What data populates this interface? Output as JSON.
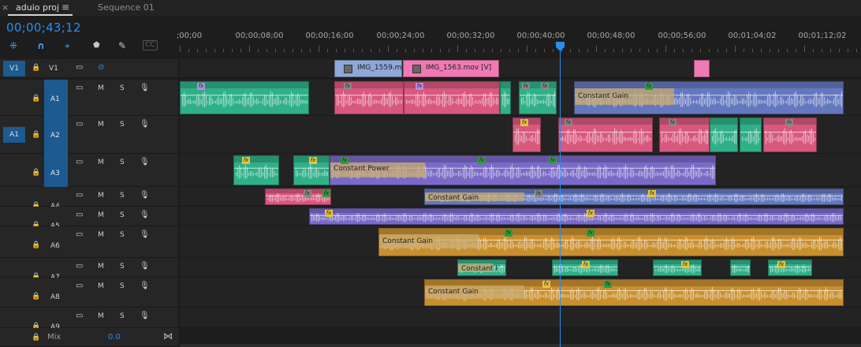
{
  "tabs": [
    {
      "label": "aduio proj",
      "active": true
    },
    {
      "label": "Sequence 01",
      "active": false
    }
  ],
  "tab_close_symbol": "×",
  "tab_menu_symbol": "≡",
  "timecode": "00;00;43;12",
  "tools": [
    {
      "name": "snap-in-sequence-icon",
      "glyph": "⁜"
    },
    {
      "name": "magnet-icon",
      "glyph": "∩"
    },
    {
      "name": "linked-selection-icon",
      "glyph": "⌖"
    },
    {
      "name": "add-marker-icon",
      "glyph": "⬟"
    },
    {
      "name": "wrench-icon",
      "glyph": "✎"
    },
    {
      "name": "captions-icon",
      "glyph": "CC"
    }
  ],
  "ruler_labels": [
    ";00;00",
    "00;00;08;00",
    "00;00;16;00",
    "00;00;24;00",
    "00;00;32;00",
    "00;00;40;00",
    "00;00;48;00",
    "00;00;56;00",
    "00;01;04;02",
    "00;01;12;02"
  ],
  "icons": {
    "lock": "🔒",
    "film": "▭",
    "eye_off": "⊘",
    "mic": "🎙"
  },
  "video_track": {
    "source": "V1",
    "name": "V1"
  },
  "audio_tracks": [
    {
      "name": "A1",
      "source": ""
    },
    {
      "name": "A2",
      "source": "A1"
    },
    {
      "name": "A3",
      "source": ""
    },
    {
      "name": "A4",
      "source": ""
    },
    {
      "name": "A5",
      "source": ""
    },
    {
      "name": "A6",
      "source": ""
    },
    {
      "name": "A7",
      "source": ""
    },
    {
      "name": "A8",
      "source": ""
    },
    {
      "name": "A9",
      "source": ""
    }
  ],
  "mute_label": "M",
  "solo_label": "S",
  "video_clips": [
    {
      "label": "IMG_1559.m",
      "color": "#8ea8d9"
    },
    {
      "label": "IMG_1563.mov [V]",
      "color": "#f07ab5"
    },
    {
      "label": "",
      "color": "#f07ab5"
    }
  ],
  "clip_labels": {
    "constant_gain": "Constant Gain",
    "constant_power": "Constant Power",
    "constant_short": "Constant",
    "constant_i": "Constant I"
  },
  "colors": {
    "green": "#2fb088",
    "pink": "#d8587e",
    "blue": "#6478c0",
    "purple": "#7a6ac8",
    "orange": "#c98f2f",
    "accent": "#2d8ceb"
  },
  "mix": {
    "label": "Mix",
    "value": "0.0"
  }
}
